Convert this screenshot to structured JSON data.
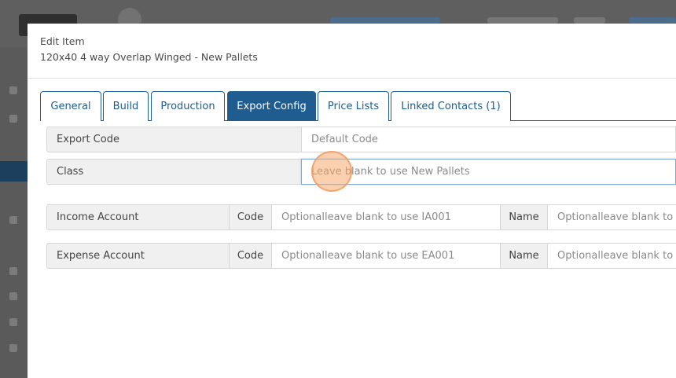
{
  "modal": {
    "title": "Edit Item",
    "subtitle": "120x40 4 way Overlap Winged - New Pallets"
  },
  "tabs": [
    {
      "label": "General",
      "active": false
    },
    {
      "label": "Build",
      "active": false
    },
    {
      "label": "Production",
      "active": false
    },
    {
      "label": "Export Config",
      "active": true
    },
    {
      "label": "Price Lists",
      "active": false
    },
    {
      "label": "Linked Contacts (1)",
      "active": false
    }
  ],
  "export_code": {
    "label": "Export Code",
    "placeholder": "Default Code"
  },
  "class_field": {
    "label": "Class",
    "placeholder": "Leave blank to use New Pallets"
  },
  "income_account": {
    "label": "Income Account",
    "code_label": "Code",
    "code_placeholder": "Optionalleave blank to use IA001",
    "name_label": "Name",
    "name_placeholder": "Optionalleave blank to use"
  },
  "expense_account": {
    "label": "Expense Account",
    "code_label": "Code",
    "code_placeholder": "Optionalleave blank to use EA001",
    "name_label": "Name",
    "name_placeholder": "Optionalleave blank to use"
  },
  "colors": {
    "accent": "#1f5c8f",
    "overlay": "#5c5c5c",
    "label_bg": "#f0f0f0",
    "click_marker": "#f7aa6e"
  }
}
